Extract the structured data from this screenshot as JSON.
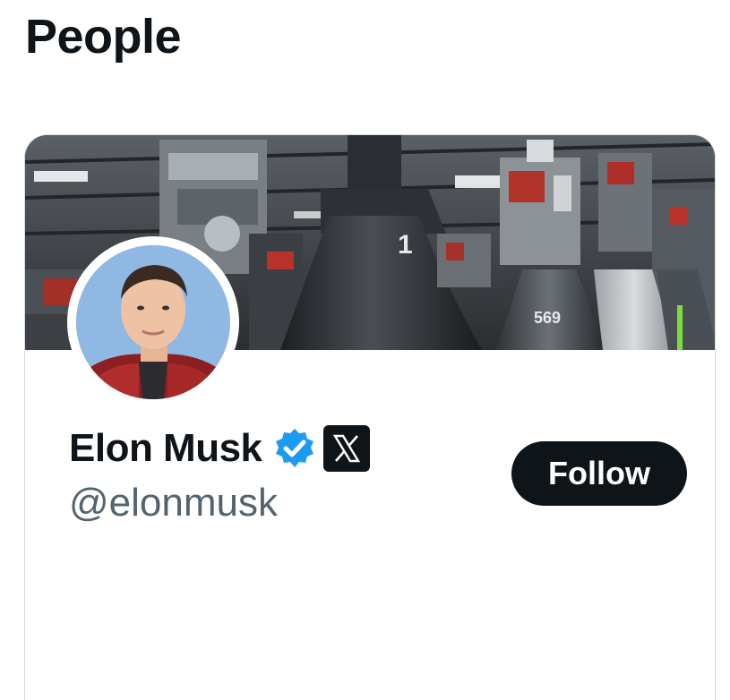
{
  "section": {
    "title": "People"
  },
  "card": {
    "display_name": "Elon Musk",
    "handle": "@elonmusk",
    "follow_label": "Follow",
    "banner": {
      "engine_label_center": "1",
      "engine_label_right": "569"
    },
    "badges": [
      "verified-badge-icon",
      "x-logo-icon"
    ],
    "colors": {
      "verified": "#1d9bf0",
      "button_bg": "#0f1419",
      "button_text": "#ffffff",
      "handle_text": "#536471",
      "name_text": "#0f1419",
      "card_border": "#d7dbdf"
    }
  }
}
